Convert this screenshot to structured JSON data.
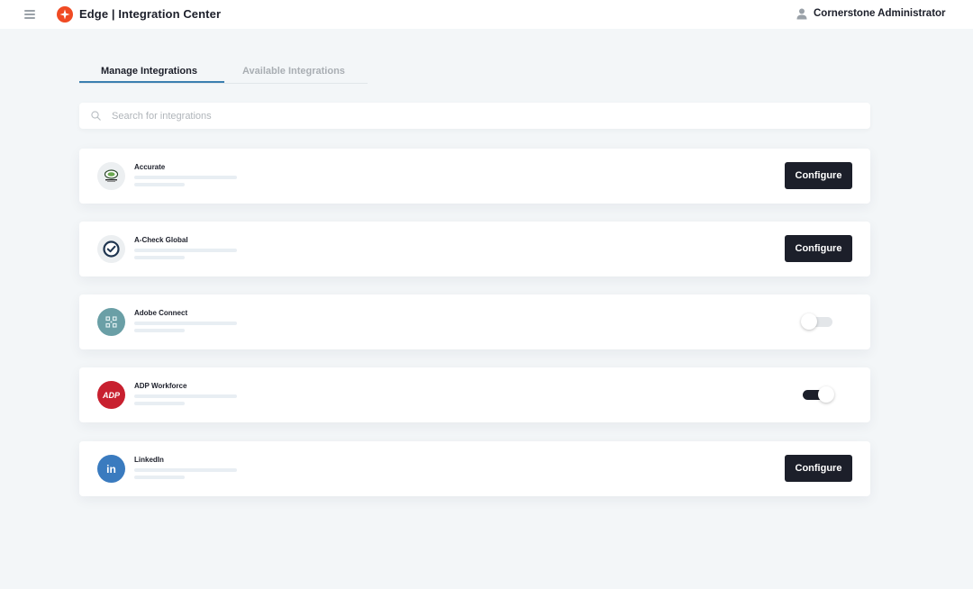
{
  "header": {
    "app_title": "Edge | Integration Center",
    "user_name": "Cornerstone Administrator",
    "logo_color": "#f04a23"
  },
  "tabs": [
    {
      "label": "Manage Integrations",
      "active": true
    },
    {
      "label": "Available Integrations",
      "active": false
    }
  ],
  "search": {
    "placeholder": "Search for integrations",
    "value": ""
  },
  "integrations": [
    {
      "name": "Accurate",
      "logo_icon": "accurate-logo-icon",
      "action": "Configure",
      "control": "button"
    },
    {
      "name": "A-Check Global",
      "logo_icon": "acheck-global-logo-icon",
      "action": "Configure",
      "control": "button"
    },
    {
      "name": "Adobe Connect",
      "logo_icon": "adobe-connect-logo-icon",
      "control": "toggle",
      "enabled": false
    },
    {
      "name": "ADP Workforce",
      "logo_icon": "adp-logo-icon",
      "logo_text": "ADP",
      "control": "toggle",
      "enabled": true
    },
    {
      "name": "LinkedIn",
      "logo_icon": "linkedin-logo-icon",
      "logo_text": "in",
      "action": "Configure",
      "control": "button"
    }
  ],
  "colors": {
    "accent": "#3b7fb0",
    "button_dark": "#1c1f2a",
    "page_background": "#f3f6f8"
  }
}
